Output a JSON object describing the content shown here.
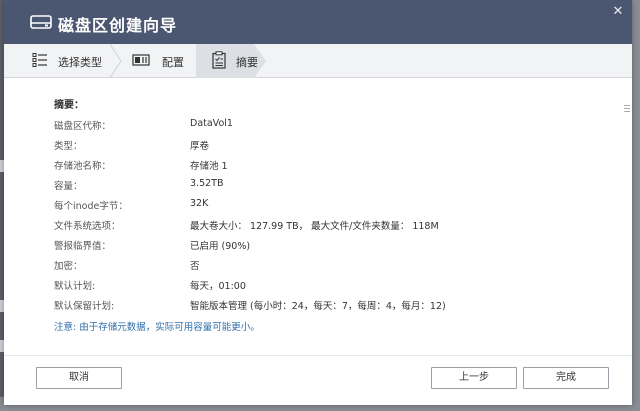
{
  "dialog": {
    "title": "磁盘区创建向导",
    "close_glyph": "✕"
  },
  "steps": [
    {
      "label": "选择类型",
      "icon": "list-icon"
    },
    {
      "label": "配置",
      "icon": "disk-config-icon"
    },
    {
      "label": "摘要",
      "icon": "clipboard-icon"
    }
  ],
  "active_step": 2,
  "summary": {
    "heading": "摘要：",
    "rows": [
      {
        "key": "磁盘区代称：",
        "value": "DataVol1"
      },
      {
        "key": "类型：",
        "value": "厚卷"
      },
      {
        "key": "存储池名称：",
        "value": "存储池 1"
      },
      {
        "key": "容量：",
        "value": "3.52TB"
      },
      {
        "key": "每个inode字节：",
        "value": "32K"
      },
      {
        "key": "文件系统选项：",
        "value": "最大卷大小： 127.99 TB， 最大文件/文件夹数量： 118M"
      },
      {
        "key": "警报临界值：",
        "value": "已启用 (90%)"
      },
      {
        "key": "加密：",
        "value": "否"
      },
      {
        "key": "默认计划:",
        "value": "每天，01:00"
      },
      {
        "key": "默认保留计划:",
        "value": "智能版本管理 (每小时：24，每天：7，每周：4，每月：12)"
      }
    ],
    "note": "注意: 由于存储元数据，实际可用容量可能更小。"
  },
  "buttons": {
    "cancel": "取消",
    "back": "上一步",
    "finish": "完成"
  },
  "colors": {
    "titlebar": "#4b5670",
    "note": "#2f6eaa",
    "step_active": "#dcdfe4"
  }
}
